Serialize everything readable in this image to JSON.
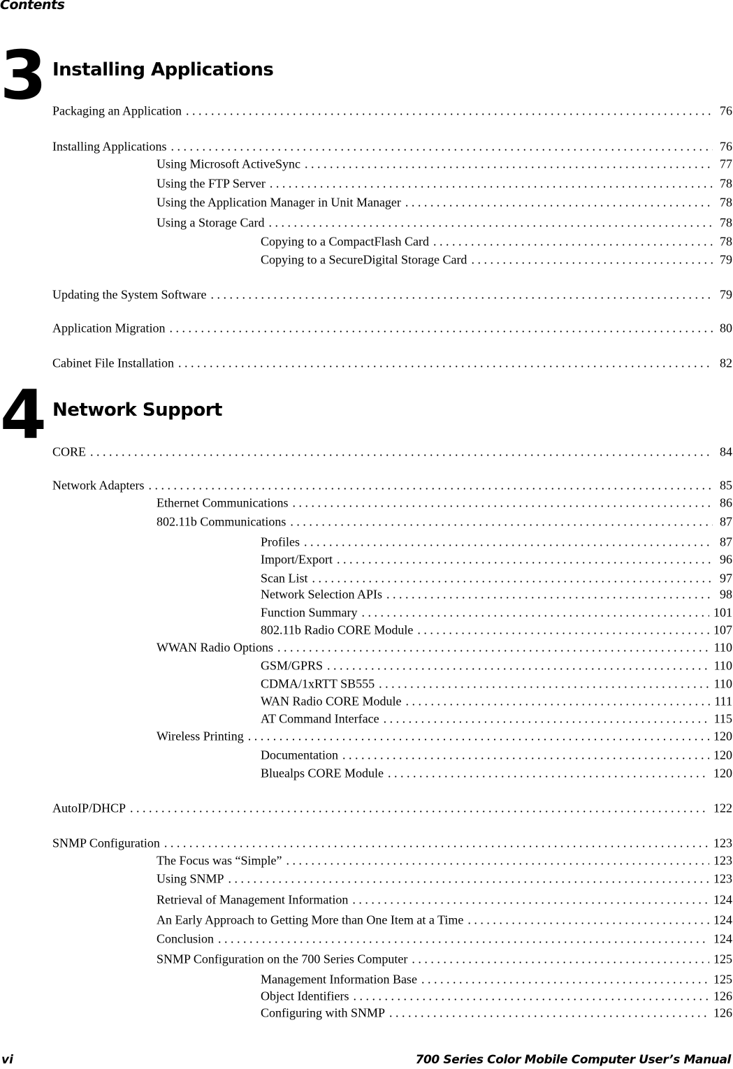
{
  "header": {
    "title": "Contents"
  },
  "chapters": [
    {
      "number": "3",
      "title": "Installing Applications",
      "entries": [
        {
          "level": 0,
          "text": "Packaging an Application",
          "page": "76"
        },
        {
          "level": 0,
          "text": "Installing Applications",
          "page": "76"
        },
        {
          "level": 1,
          "text": "Using Microsoft ActiveSync",
          "page": "77"
        },
        {
          "level": 1,
          "text": "Using the FTP Server",
          "page": "78"
        },
        {
          "level": 1,
          "text": "Using the Application Manager in Unit Manager",
          "page": "78"
        },
        {
          "level": 1,
          "text": "Using a Storage Card",
          "page": "78"
        },
        {
          "level": 2,
          "text": "Copying to a CompactFlash Card",
          "page": "78"
        },
        {
          "level": 2,
          "text": "Copying to a SecureDigital Storage Card",
          "page": "79"
        },
        {
          "level": 0,
          "text": "Updating the System Software",
          "page": "79"
        },
        {
          "level": 0,
          "text": "Application Migration",
          "page": "80"
        },
        {
          "level": 0,
          "text": "Cabinet File Installation",
          "page": "82"
        }
      ]
    },
    {
      "number": "4",
      "title": "Network Support",
      "entries": [
        {
          "level": 0,
          "text": "CORE",
          "page": "84"
        },
        {
          "level": 0,
          "text": "Network Adapters",
          "page": "85"
        },
        {
          "level": 1,
          "text": "Ethernet Communications",
          "page": "86"
        },
        {
          "level": 1,
          "text": "802.11b Communications",
          "page": "87"
        },
        {
          "level": 2,
          "text": "Profiles",
          "page": "87"
        },
        {
          "level": 2,
          "text": "Import/Export",
          "page": "96"
        },
        {
          "level": 2,
          "text": "Scan List",
          "page": "97"
        },
        {
          "level": 2,
          "text": "Network Selection APIs",
          "page": "98"
        },
        {
          "level": 2,
          "text": "Function Summary",
          "page": "101"
        },
        {
          "level": 2,
          "text": "802.11b Radio CORE Module",
          "page": "107"
        },
        {
          "level": 1,
          "text": "WWAN Radio Options",
          "page": "110"
        },
        {
          "level": 2,
          "text": "GSM/GPRS",
          "page": "110"
        },
        {
          "level": 2,
          "text": "CDMA/1xRTT SB555",
          "page": "110"
        },
        {
          "level": 2,
          "text": "WAN Radio CORE Module",
          "page": "111"
        },
        {
          "level": 2,
          "text": "AT Command Interface",
          "page": "115"
        },
        {
          "level": 1,
          "text": "Wireless Printing",
          "page": "120"
        },
        {
          "level": 2,
          "text": "Documentation",
          "page": "120"
        },
        {
          "level": 2,
          "text": "Bluealps CORE Module",
          "page": "120"
        },
        {
          "level": 0,
          "text": "AutoIP/DHCP",
          "page": "122"
        },
        {
          "level": 0,
          "text": "SNMP Configuration",
          "page": "123"
        },
        {
          "level": 1,
          "text": "The Focus was “Simple”",
          "page": "123"
        },
        {
          "level": 1,
          "text": "Using SNMP",
          "page": "123"
        },
        {
          "level": 1,
          "text": "Retrieval of Management Information",
          "page": "124"
        },
        {
          "level": 1,
          "text": "An Early Approach to Getting More than One Item at a Time",
          "page": "124"
        },
        {
          "level": 1,
          "text": "Conclusion",
          "page": "124"
        },
        {
          "level": 1,
          "text": "SNMP Configuration on the 700 Series Computer",
          "page": "125"
        },
        {
          "level": 2,
          "text": "Management Information Base",
          "page": "125"
        },
        {
          "level": 2,
          "text": "Object Identifiers",
          "page": "126"
        },
        {
          "level": 2,
          "text": "Configuring with SNMP",
          "page": "126"
        }
      ]
    }
  ],
  "footer": {
    "page": "vi",
    "title": "700 Series Color Mobile Computer User’s Manual"
  }
}
